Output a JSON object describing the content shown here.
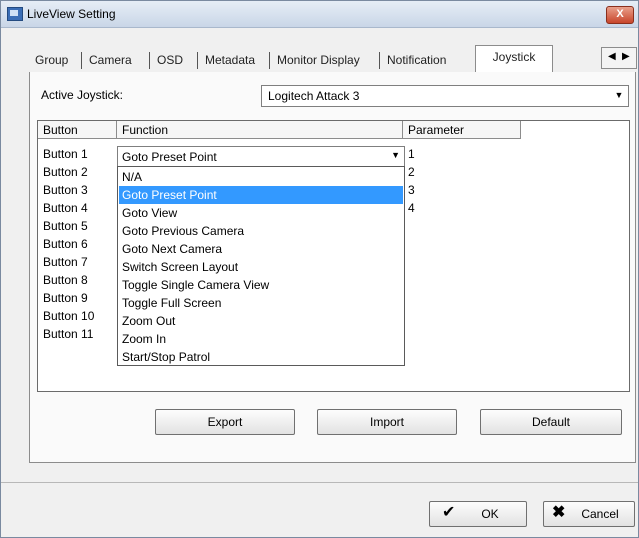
{
  "window": {
    "title": "LiveView Setting",
    "close_label": "X"
  },
  "tabs": [
    "Group",
    "Camera",
    "OSD",
    "Metadata",
    "Monitor Display",
    "Notification",
    "Joystick"
  ],
  "active_tab": "Joystick",
  "scroll_left": "◀",
  "scroll_right": "▶",
  "active_joystick": {
    "label": "Active Joystick:",
    "value": "Logitech Attack 3"
  },
  "table": {
    "headers": [
      "Button",
      "Function",
      "Parameter"
    ],
    "buttons": [
      "Button 1",
      "Button 2",
      "Button 3",
      "Button 4",
      "Button 5",
      "Button 6",
      "Button 7",
      "Button 8",
      "Button 9",
      "Button 10",
      "Button 11"
    ],
    "parameters": [
      "1",
      "2",
      "3",
      "4"
    ],
    "function_selected": "Goto Preset Point",
    "function_options": [
      "N/A",
      "Goto Preset Point",
      "Goto View",
      "Goto Previous Camera",
      "Goto Next Camera",
      "Switch Screen Layout",
      "Toggle Single Camera View",
      "Toggle Full Screen",
      "Zoom Out",
      "Zoom In",
      "Start/Stop Patrol"
    ],
    "highlighted_option": "Goto Preset Point"
  },
  "actions": {
    "export": "Export",
    "import": "Import",
    "default": "Default"
  },
  "dialog": {
    "ok": "OK",
    "cancel": "Cancel"
  },
  "icons": {
    "check": "✔",
    "cross": "✖",
    "dropdown": "▼"
  }
}
